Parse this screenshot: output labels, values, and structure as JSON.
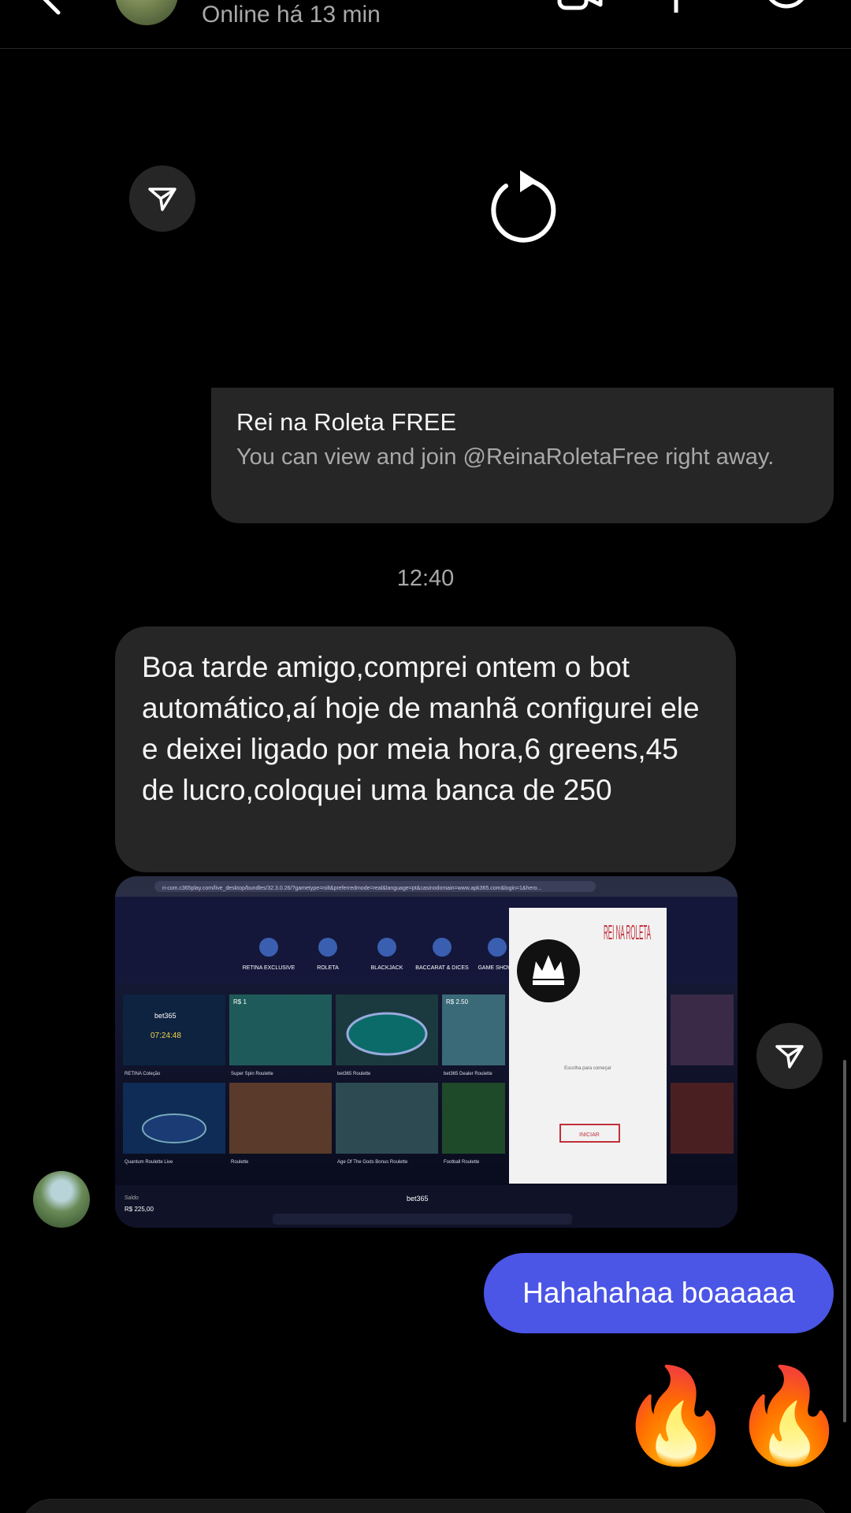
{
  "header": {
    "status": "Online há 13 min",
    "icons": [
      "back-arrow-icon",
      "video-call-icon",
      "flag-icon",
      "info-icon"
    ]
  },
  "link_card": {
    "title": "Rei na Roleta FREE",
    "description": "You can view and join @ReinaRoletaFree right away."
  },
  "timestamp": "12:40",
  "messages": {
    "incoming_text": "Boa tarde amigo,comprei ontem o bot automático,aí hoje de manhã configurei ele e deixei ligado por meia hora,6 greens,45 de lucro,coloquei uma banca de 250",
    "outgoing_text": "Hahahahaa boaaaaa",
    "reaction": "🔥"
  },
  "photo": {
    "url_bar": "ri-com.c365play.com/live_desktop/bundles/32.3.0.26/?gametype=rolt&preferredmode=real&language=pt&casinodomain=www.apk365.com&login=1&hero...",
    "categories": [
      "RETINA EXCLUSIVE",
      "ROLETA",
      "BLACKJACK",
      "BACCARAT & DICES",
      "GAME SHOWS"
    ],
    "tile_labels": [
      "RETINA Coleção",
      "Super Spin Roulette",
      "bet365 Roulette",
      "bet365 Dealer Roulette",
      "Quantum Roulette Live",
      "Roulette",
      "Age Of The Gods Bonus Roulette",
      "Football Roulette"
    ],
    "promo_price_1": "R$ 1",
    "promo_price_2": "R$ 2.50",
    "countdown": "07:24:48",
    "popup": {
      "brand": "REI NA ROLETA",
      "caption": "Escolha para começar",
      "button": "INICIAR"
    },
    "footer_brand": "bet365",
    "balance_label": "Saldo",
    "balance": "R$ 225,00"
  },
  "colors": {
    "background": "#000000",
    "bubble_in": "#262626",
    "bubble_out": "#4b55e6",
    "secondary_text": "#a8a8a8"
  }
}
